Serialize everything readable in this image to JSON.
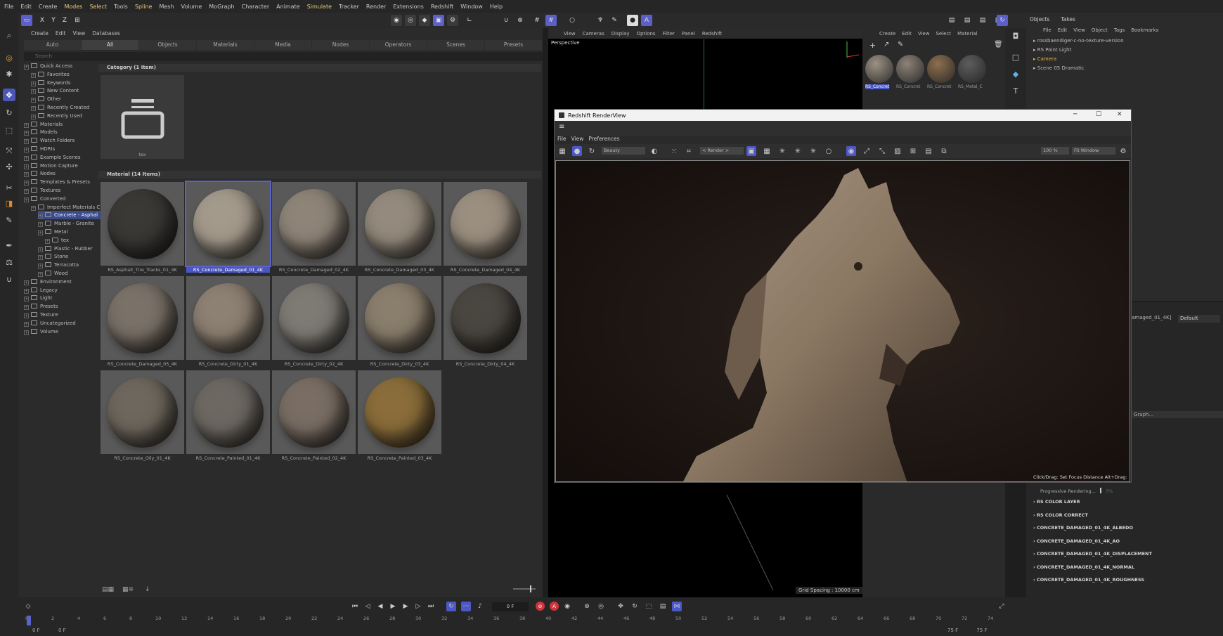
{
  "menubar": [
    "File",
    "Edit",
    "Create",
    "Modes",
    "Select",
    "Tools",
    "Spline",
    "Mesh",
    "Volume",
    "MoGraph",
    "Character",
    "Animate",
    "Simulate",
    "Tracker",
    "Render",
    "Extensions",
    "Redshift",
    "Window",
    "Help"
  ],
  "menubar_highlight": [
    "Modes",
    "Select",
    "Spline",
    "Simulate"
  ],
  "asset_browser": {
    "menu": [
      "Create",
      "Edit",
      "View",
      "Databases"
    ],
    "tabs": [
      "Auto",
      "All",
      "Objects",
      "Materials",
      "Media",
      "Nodes",
      "Operators",
      "Scenes",
      "Presets"
    ],
    "selected_tab": "All",
    "search_placeholder": "Search",
    "tree": [
      {
        "label": "Quick Access",
        "indent": 0
      },
      {
        "label": "Favorites",
        "indent": 1
      },
      {
        "label": "Keywords",
        "indent": 1
      },
      {
        "label": "New Content",
        "indent": 1
      },
      {
        "label": "Other",
        "indent": 1
      },
      {
        "label": "Recently Created",
        "indent": 1
      },
      {
        "label": "Recently Used",
        "indent": 1
      },
      {
        "label": "Materials",
        "indent": 0
      },
      {
        "label": "Models",
        "indent": 0
      },
      {
        "label": "Watch Folders",
        "indent": 0
      },
      {
        "label": "HDRIs",
        "indent": 0
      },
      {
        "label": "Example Scenes",
        "indent": 0
      },
      {
        "label": "Motion Capture",
        "indent": 0
      },
      {
        "label": "Nodes",
        "indent": 0
      },
      {
        "label": "Templates & Presets",
        "indent": 0
      },
      {
        "label": "Textures",
        "indent": 0
      },
      {
        "label": "Converted",
        "indent": 0
      },
      {
        "label": "Imperfect Materials C",
        "indent": 1
      },
      {
        "label": "Concrete - Asphal",
        "indent": 2,
        "selected": true
      },
      {
        "label": "Marble - Granite",
        "indent": 2
      },
      {
        "label": "Metal",
        "indent": 2
      },
      {
        "label": "tex",
        "indent": 3
      },
      {
        "label": "Plastic - Rubber",
        "indent": 2
      },
      {
        "label": "Stone",
        "indent": 2
      },
      {
        "label": "Terracotta",
        "indent": 2
      },
      {
        "label": "Wood",
        "indent": 2
      },
      {
        "label": "Environment",
        "indent": 0
      },
      {
        "label": "Legacy",
        "indent": 0
      },
      {
        "label": "Light",
        "indent": 0
      },
      {
        "label": "Presets",
        "indent": 0
      },
      {
        "label": "Texture",
        "indent": 0
      },
      {
        "label": "Uncategorized",
        "indent": 0
      },
      {
        "label": "Volume",
        "indent": 0
      }
    ],
    "category_header": "Category (1 Item)",
    "category_item": "tex",
    "material_header": "Material (14 Items)",
    "materials": [
      {
        "name": "RS_Asphalt_Tire_Tracks_01_4K",
        "color": "#3b3936"
      },
      {
        "name": "RS_Concrete_Damaged_01_4K",
        "color": "#a49a8c",
        "selected": true
      },
      {
        "name": "RS_Concrete_Damaged_02_4K",
        "color": "#8e8478"
      },
      {
        "name": "RS_Concrete_Damaged_03_4K",
        "color": "#948a7d"
      },
      {
        "name": "RS_Concrete_Damaged_04_4K",
        "color": "#9b8f80"
      },
      {
        "name": "RS_Concrete_Damaged_05_4K",
        "color": "#7a7168"
      },
      {
        "name": "RS_Concrete_Dirty_01_4K",
        "color": "#8d8173"
      },
      {
        "name": "RS_Concrete_Dirty_02_4K",
        "color": "#7e7a74"
      },
      {
        "name": "RS_Concrete_Dirty_03_4K",
        "color": "#8a7e6c"
      },
      {
        "name": "RS_Concrete_Dirty_04_4K",
        "color": "#4a4640"
      },
      {
        "name": "RS_Concrete_Oily_01_4K",
        "color": "#6e675d"
      },
      {
        "name": "RS_Concrete_Painted_01_4K",
        "color": "#6d6862"
      },
      {
        "name": "RS_Concrete_Painted_02_4K",
        "color": "#7a6e64"
      },
      {
        "name": "RS_Concrete_Painted_03_4K",
        "color": "#8a6d3a"
      }
    ]
  },
  "viewport": {
    "menu": [
      "View",
      "Cameras",
      "Display",
      "Options",
      "Filter",
      "Panel",
      "Redshift"
    ],
    "label": "Perspective",
    "grid_spacing": "Grid Spacing : 10000 cm"
  },
  "material_manager": {
    "menu": [
      "Create",
      "Edit",
      "View",
      "Select",
      "Material"
    ],
    "swatches": [
      {
        "name": "RS_Concret",
        "color": "#9c9284"
      },
      {
        "name": "RS_Concret",
        "color": "#8d8377"
      },
      {
        "name": "RS_Concret",
        "color": "#8e6f4f"
      },
      {
        "name": "RS_Metal_C",
        "color": "#5d5d5d"
      }
    ]
  },
  "objects": {
    "tabs": [
      "Objects",
      "Takes"
    ],
    "menu": [
      "File",
      "Edit",
      "View",
      "Object",
      "Tags",
      "Bookmarks"
    ],
    "rows": [
      {
        "label": "rossbaendiger-c-no-texture-version",
        "color": "#bcbcbc"
      },
      {
        "label": "RS Point Light",
        "color": "#bcbcbc"
      },
      {
        "label": "Camera",
        "color": "#e8b04a"
      },
      {
        "label": "Scene 05 Dramatic",
        "color": "#bcbcbc"
      }
    ]
  },
  "attributes": {
    "field_value": "amaged_01_4K]",
    "dropdown": "Default",
    "graph_btn": "Graph...",
    "layers": [
      "RS COLOR LAYER",
      "RS COLOR CORRECT",
      "CONCRETE_DAMAGED_01_4K_ALBEDO",
      "CONCRETE_DAMAGED_01_4K_AO",
      "CONCRETE_DAMAGED_01_4K_DISPLACEMENT",
      "CONCRETE_DAMAGED_01_4K_NORMAL",
      "CONCRETE_DAMAGED_01_4K_ROUGHNESS"
    ]
  },
  "render_view": {
    "title": "Redshift RenderView",
    "menu": [
      "File",
      "View",
      "Preferences"
    ],
    "aov": "Beauty",
    "render_dd": "< Render >",
    "zoom": "100 %",
    "fit": "Fit Window",
    "hint": "Click/Drag: Set Focus Distance Alt+Drag:",
    "status": "Progressive Rendering...",
    "status_pct": "3%"
  },
  "timeline": {
    "current_frame": "0 F",
    "start": "0 F",
    "start2": "0 F",
    "end": "75 F",
    "end2": "75 F",
    "ticks": [
      "0",
      "2",
      "4",
      "6",
      "8",
      "10",
      "12",
      "14",
      "16",
      "18",
      "20",
      "22",
      "24",
      "26",
      "28",
      "30",
      "32",
      "34",
      "36",
      "38",
      "40",
      "42",
      "44",
      "46",
      "48",
      "50",
      "52",
      "54",
      "56",
      "58",
      "60",
      "62",
      "64",
      "66",
      "68",
      "70",
      "72",
      "74"
    ]
  }
}
